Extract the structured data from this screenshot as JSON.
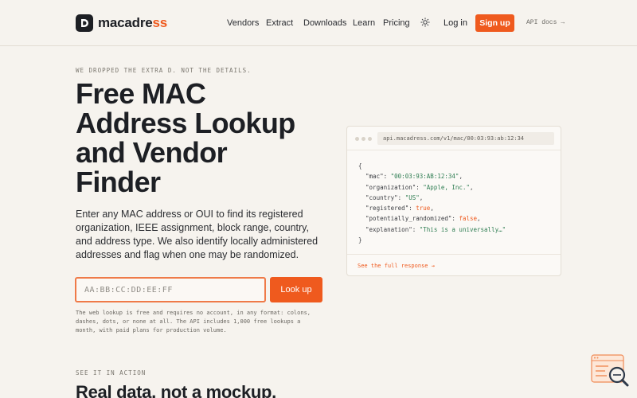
{
  "brand": {
    "name_prefix": "macadre",
    "name_accent": "ss",
    "accent_color": "#ef5a1e"
  },
  "nav": {
    "items": [
      {
        "label": "Vendors"
      },
      {
        "label": "Extract"
      },
      {
        "label": "Downloads"
      },
      {
        "label": "Learn"
      },
      {
        "label": "Pricing"
      }
    ],
    "theme_icon": "sun-icon",
    "login": "Log in",
    "signup": "Sign up",
    "api_docs": "API docs →"
  },
  "hero": {
    "eyebrow": "WE DROPPED THE EXTRA D. NOT THE DETAILS.",
    "title": "Free MAC Address Lookup and Vendor Finder",
    "description": "Enter any MAC address or OUI to find its registered organization, IEEE assignment, block range, country, and address type. We also identify locally administered addresses and flag when one may be randomized.",
    "input_placeholder": "AA:BB:CC:DD:EE:FF",
    "lookup_button": "Look up",
    "helper": "The web lookup is free and requires no account, in any format: colons, dashes, dots, or none at all. The API includes 1,000 free lookups a month, with paid plans for production volume."
  },
  "api_card": {
    "url": "api.macadress.com/v1/mac/00:03:93:ab:12:34",
    "lines": [
      {
        "key": "\"mac\"",
        "value": "\"00:03:93:AB:12:34\"",
        "kind": "string"
      },
      {
        "key": "\"organization\"",
        "value": "\"Apple, Inc.\"",
        "kind": "string"
      },
      {
        "key": "\"country\"",
        "value": "\"US\"",
        "kind": "string"
      },
      {
        "key": "\"registered\"",
        "value": "true",
        "kind": "bool"
      },
      {
        "key": "\"potentially_randomized\"",
        "value": "false",
        "kind": "bool"
      },
      {
        "key": "\"explanation\"",
        "value": "\"This is a universally…\"",
        "kind": "string",
        "last": true
      }
    ],
    "full_response_link": "See the full response →"
  },
  "section": {
    "eyebrow": "SEE IT IN ACTION",
    "title": "Real data, not a mockup."
  },
  "widget": {
    "icon": "search-widget-icon"
  }
}
